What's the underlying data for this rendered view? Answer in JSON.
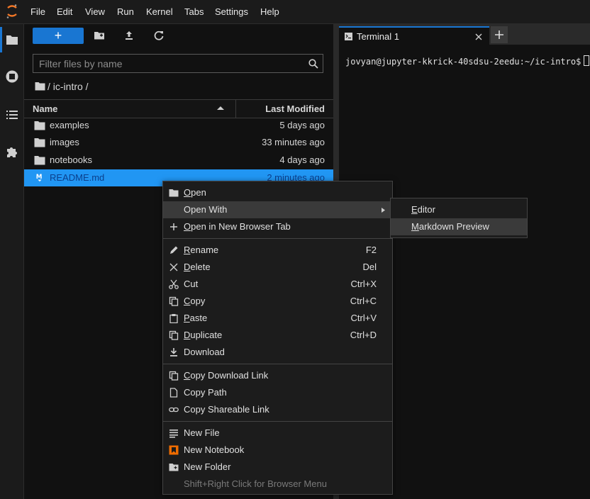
{
  "menubar": {
    "items": [
      "File",
      "Edit",
      "View",
      "Run",
      "Kernel",
      "Tabs",
      "Settings",
      "Help"
    ]
  },
  "filebrowser": {
    "new_label": "+",
    "filter_placeholder": "Filter files by name",
    "breadcrumb": "/ ic-intro /",
    "col_name": "Name",
    "col_modified": "Last Modified",
    "files": [
      {
        "name": "examples",
        "modified": "5 days ago",
        "icon": "folder-icon"
      },
      {
        "name": "images",
        "modified": "33 minutes ago",
        "icon": "folder-icon"
      },
      {
        "name": "notebooks",
        "modified": "4 days ago",
        "icon": "folder-icon"
      },
      {
        "name": "README.md",
        "modified": "2 minutes ago",
        "icon": "markdown-icon"
      }
    ]
  },
  "terminal": {
    "tab_label": "Terminal 1",
    "prompt": "jovyan@jupyter-kkrick-40sdsu-2eedu:~/ic-intro$"
  },
  "context_menu": {
    "items": [
      {
        "label": "Open",
        "mnemonic": "O",
        "rest": "pen",
        "shortcut": "",
        "icon": "folder-icon"
      },
      {
        "label": "Open With",
        "shortcut": "",
        "icon": "",
        "submenu": true
      },
      {
        "label": "Open in New Browser Tab",
        "mnemonic": "O",
        "rest": "pen in New Browser Tab",
        "shortcut": "",
        "icon": "plus-icon"
      },
      {
        "label": "Rename",
        "mnemonic": "R",
        "rest": "ename",
        "shortcut": "F2",
        "icon": "pencil-icon"
      },
      {
        "label": "Delete",
        "mnemonic": "D",
        "rest": "elete",
        "shortcut": "Del",
        "icon": "close-icon"
      },
      {
        "label": "Cut",
        "mnemonic": "C",
        "rest": "ut",
        "shortcut": "Ctrl+X",
        "icon": "scissors-icon"
      },
      {
        "label": "Copy",
        "mnemonic": "C",
        "rest": "opy",
        "shortcut": "Ctrl+C",
        "icon": "copy-icon"
      },
      {
        "label": "Paste",
        "mnemonic": "P",
        "rest": "aste",
        "shortcut": "Ctrl+V",
        "icon": "clipboard-icon"
      },
      {
        "label": "Duplicate",
        "mnemonic": "D",
        "rest": "uplicate",
        "shortcut": "Ctrl+D",
        "icon": "copy-icon"
      },
      {
        "label": "Download",
        "shortcut": "",
        "icon": "download-icon"
      },
      {
        "label": "Copy Download Link",
        "mnemonic": "C",
        "rest": "opy Download Link",
        "shortcut": "",
        "icon": "copy-icon"
      },
      {
        "label": "Copy Path",
        "shortcut": "",
        "icon": "file-icon"
      },
      {
        "label": "Copy Shareable Link",
        "shortcut": "",
        "icon": "link-icon"
      },
      {
        "label": "New File",
        "shortcut": "",
        "icon": "text-file-icon"
      },
      {
        "label": "New Notebook",
        "shortcut": "",
        "icon": "notebook-icon"
      },
      {
        "label": "New Folder",
        "shortcut": "",
        "icon": "new-folder-icon"
      },
      {
        "label": "Shift+Right Click for Browser Menu",
        "shortcut": "",
        "icon": "",
        "disabled": true
      }
    ]
  },
  "submenu": {
    "items": [
      {
        "label": "Editor",
        "mnemonic": "E",
        "rest": "ditor"
      },
      {
        "label": "Markdown Preview",
        "mnemonic": "M",
        "rest": "arkdown Preview"
      }
    ]
  },
  "colors": {
    "accent": "#1976d2",
    "selected_row": "#2196f3",
    "menu_bg": "#1c1c1c",
    "menu_hover": "#3a3a3a"
  }
}
